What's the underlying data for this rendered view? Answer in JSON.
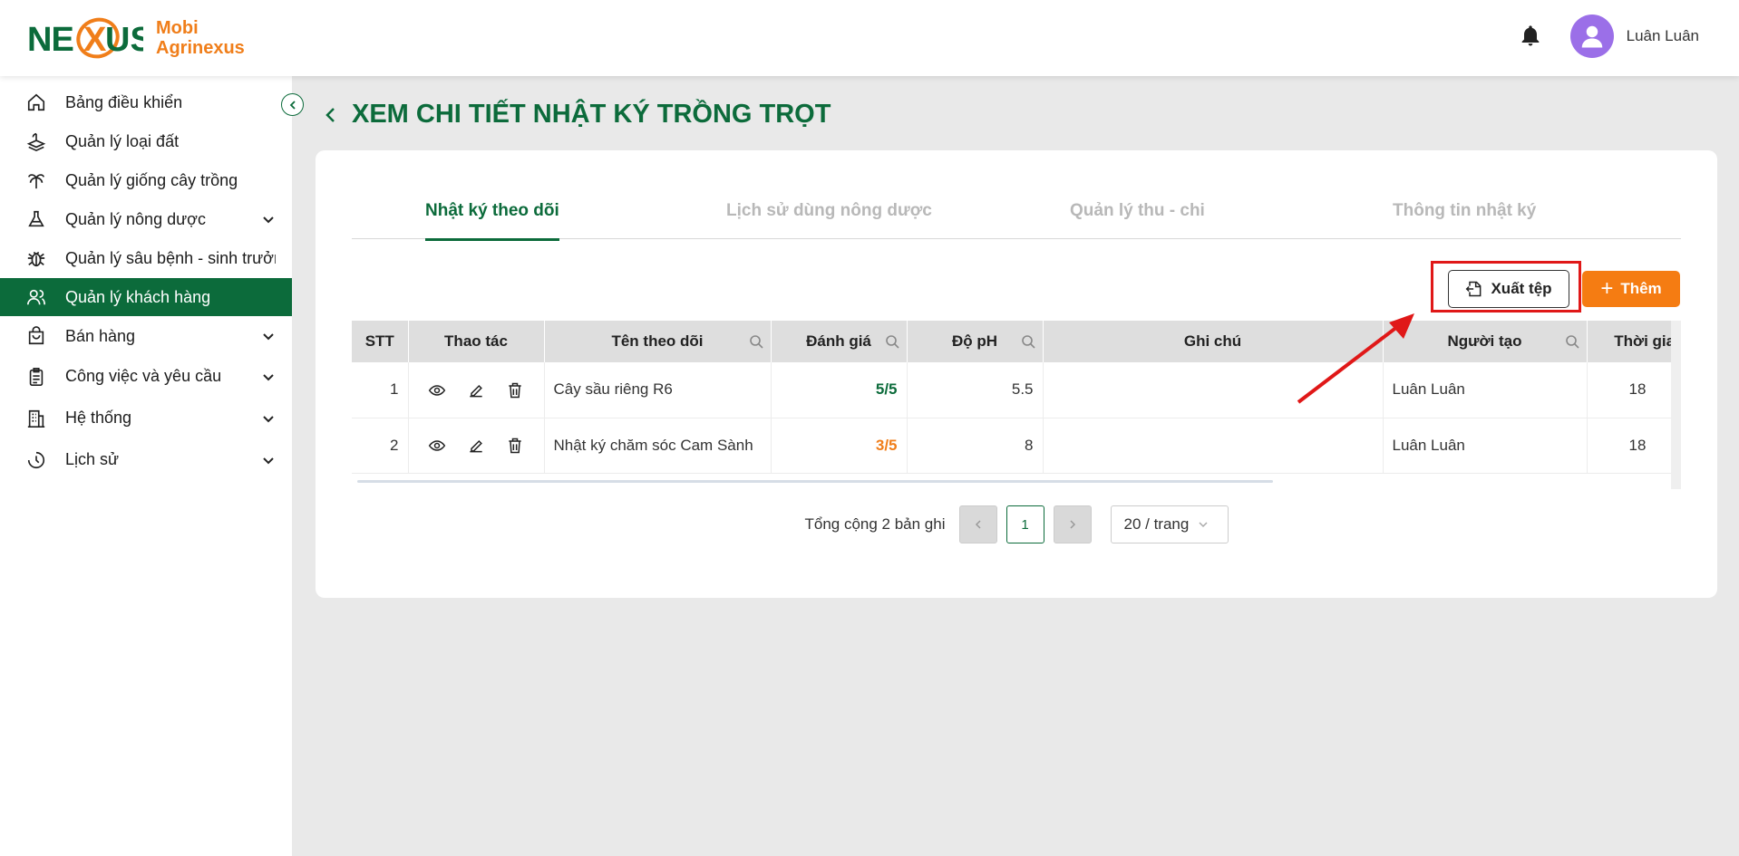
{
  "header": {
    "brand_line1": "Mobi",
    "brand_line2": "Agrinexus",
    "logo_text": "NEXUS",
    "user_name": "Luân Luân"
  },
  "sidebar": {
    "items": [
      {
        "label": "Bảng điều khiển"
      },
      {
        "label": "Quản lý loại đất"
      },
      {
        "label": "Quản lý giống cây trồng"
      },
      {
        "label": "Quản lý nông dược"
      },
      {
        "label": "Quản lý sâu bệnh - sinh trưởng"
      },
      {
        "label": "Quản lý khách hàng"
      },
      {
        "label": "Bán hàng"
      },
      {
        "label": "Công việc và yêu cầu"
      },
      {
        "label": "Hệ thống"
      },
      {
        "label": "Lịch sử"
      }
    ]
  },
  "page": {
    "title": "XEM CHI TIẾT NHẬT KÝ TRỒNG TRỌT"
  },
  "tabs": [
    {
      "label": "Nhật ký theo dõi"
    },
    {
      "label": "Lịch sử dùng nông dược"
    },
    {
      "label": "Quản lý thu - chi"
    },
    {
      "label": "Thông tin nhật ký"
    }
  ],
  "toolbar": {
    "export_label": "Xuất tệp",
    "add_label": "Thêm"
  },
  "table": {
    "columns": [
      "STT",
      "Thao tác",
      "Tên theo dõi",
      "Đánh giá",
      "Độ pH",
      "Ghi chú",
      "Người tạo",
      "Thời gian tạo"
    ],
    "rows": [
      {
        "stt": "1",
        "name": "Cây sầu riêng R6",
        "rating": "5/5",
        "ph": "5.5",
        "note": "",
        "creator": "Luân Luân",
        "time": "18"
      },
      {
        "stt": "2",
        "name": "Nhật ký chăm sóc Cam Sành",
        "rating": "3/5",
        "ph": "8",
        "note": "",
        "creator": "Luân Luân",
        "time": "18"
      }
    ]
  },
  "pagination": {
    "total_text": "Tổng cộng 2 bản ghi",
    "current_page": "1",
    "page_size": "20 / trang"
  },
  "colors": {
    "primary": "#0c6b3b",
    "accent": "#f57c12",
    "highlight": "#e01818"
  }
}
